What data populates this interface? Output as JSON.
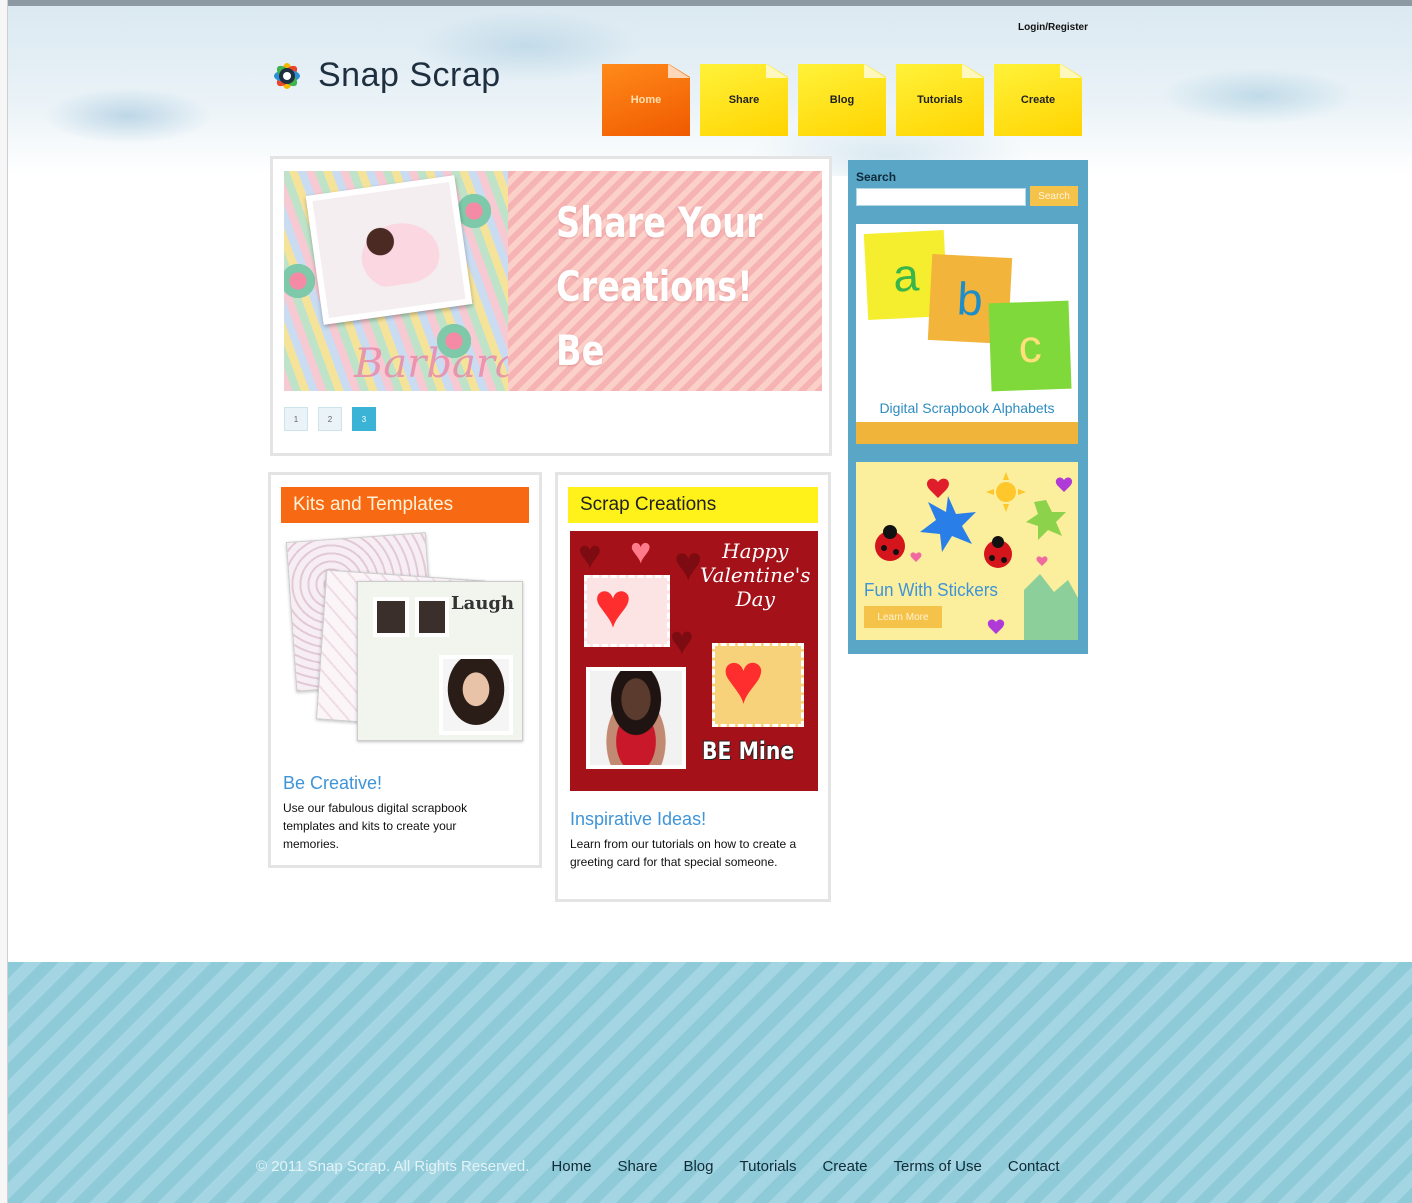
{
  "header": {
    "logo_text": "Snap Scrap",
    "login_link": "Login/Register",
    "nav": [
      {
        "label": "Home",
        "active": true
      },
      {
        "label": "Share",
        "active": false
      },
      {
        "label": "Blog",
        "active": false
      },
      {
        "label": "Tutorials",
        "active": false
      },
      {
        "label": "Create",
        "active": false
      }
    ]
  },
  "hero": {
    "line1": "Share Your",
    "line2": "Creations!",
    "line3": "Be Inspired",
    "photo_name": "Barbara",
    "pager": [
      "1",
      "2",
      "3"
    ],
    "active_page": "3"
  },
  "kits": {
    "heading": "Kits and Templates",
    "image_label": "Laugh",
    "title": "Be Creative!",
    "description": "Use our fabulous digital scrapbook templates and kits to create your memories."
  },
  "scrap": {
    "heading": "Scrap Creations",
    "image_line1": "Happy",
    "image_line2": "Valentine's",
    "image_line3": "Day",
    "image_caption": "BE Mine",
    "title": "Inspirative Ideas!",
    "description": "Learn from our tutorials on how to create a greeting card for that special someone."
  },
  "sidebar": {
    "search_label": "Search",
    "search_value": "",
    "search_button": "Search",
    "abc_letters": [
      "a",
      "b",
      "c"
    ],
    "abc_caption": "Digital Scrapbook Alphabets",
    "stickers_caption": "Fun With Stickers",
    "stickers_button": "Learn More"
  },
  "footer": {
    "copyright": "© 2011 Snap Scrap. All Rights Reserved.",
    "links": [
      "Home",
      "Share",
      "Blog",
      "Tutorials",
      "Create",
      "Terms of Use",
      "Contact"
    ]
  },
  "colors": {
    "accent_orange": "#f76a13",
    "accent_yellow": "#fff21a",
    "sidebar_blue": "#5aa6c6",
    "link_blue": "#3f94d8",
    "footer_blue": "#9ad0de"
  }
}
